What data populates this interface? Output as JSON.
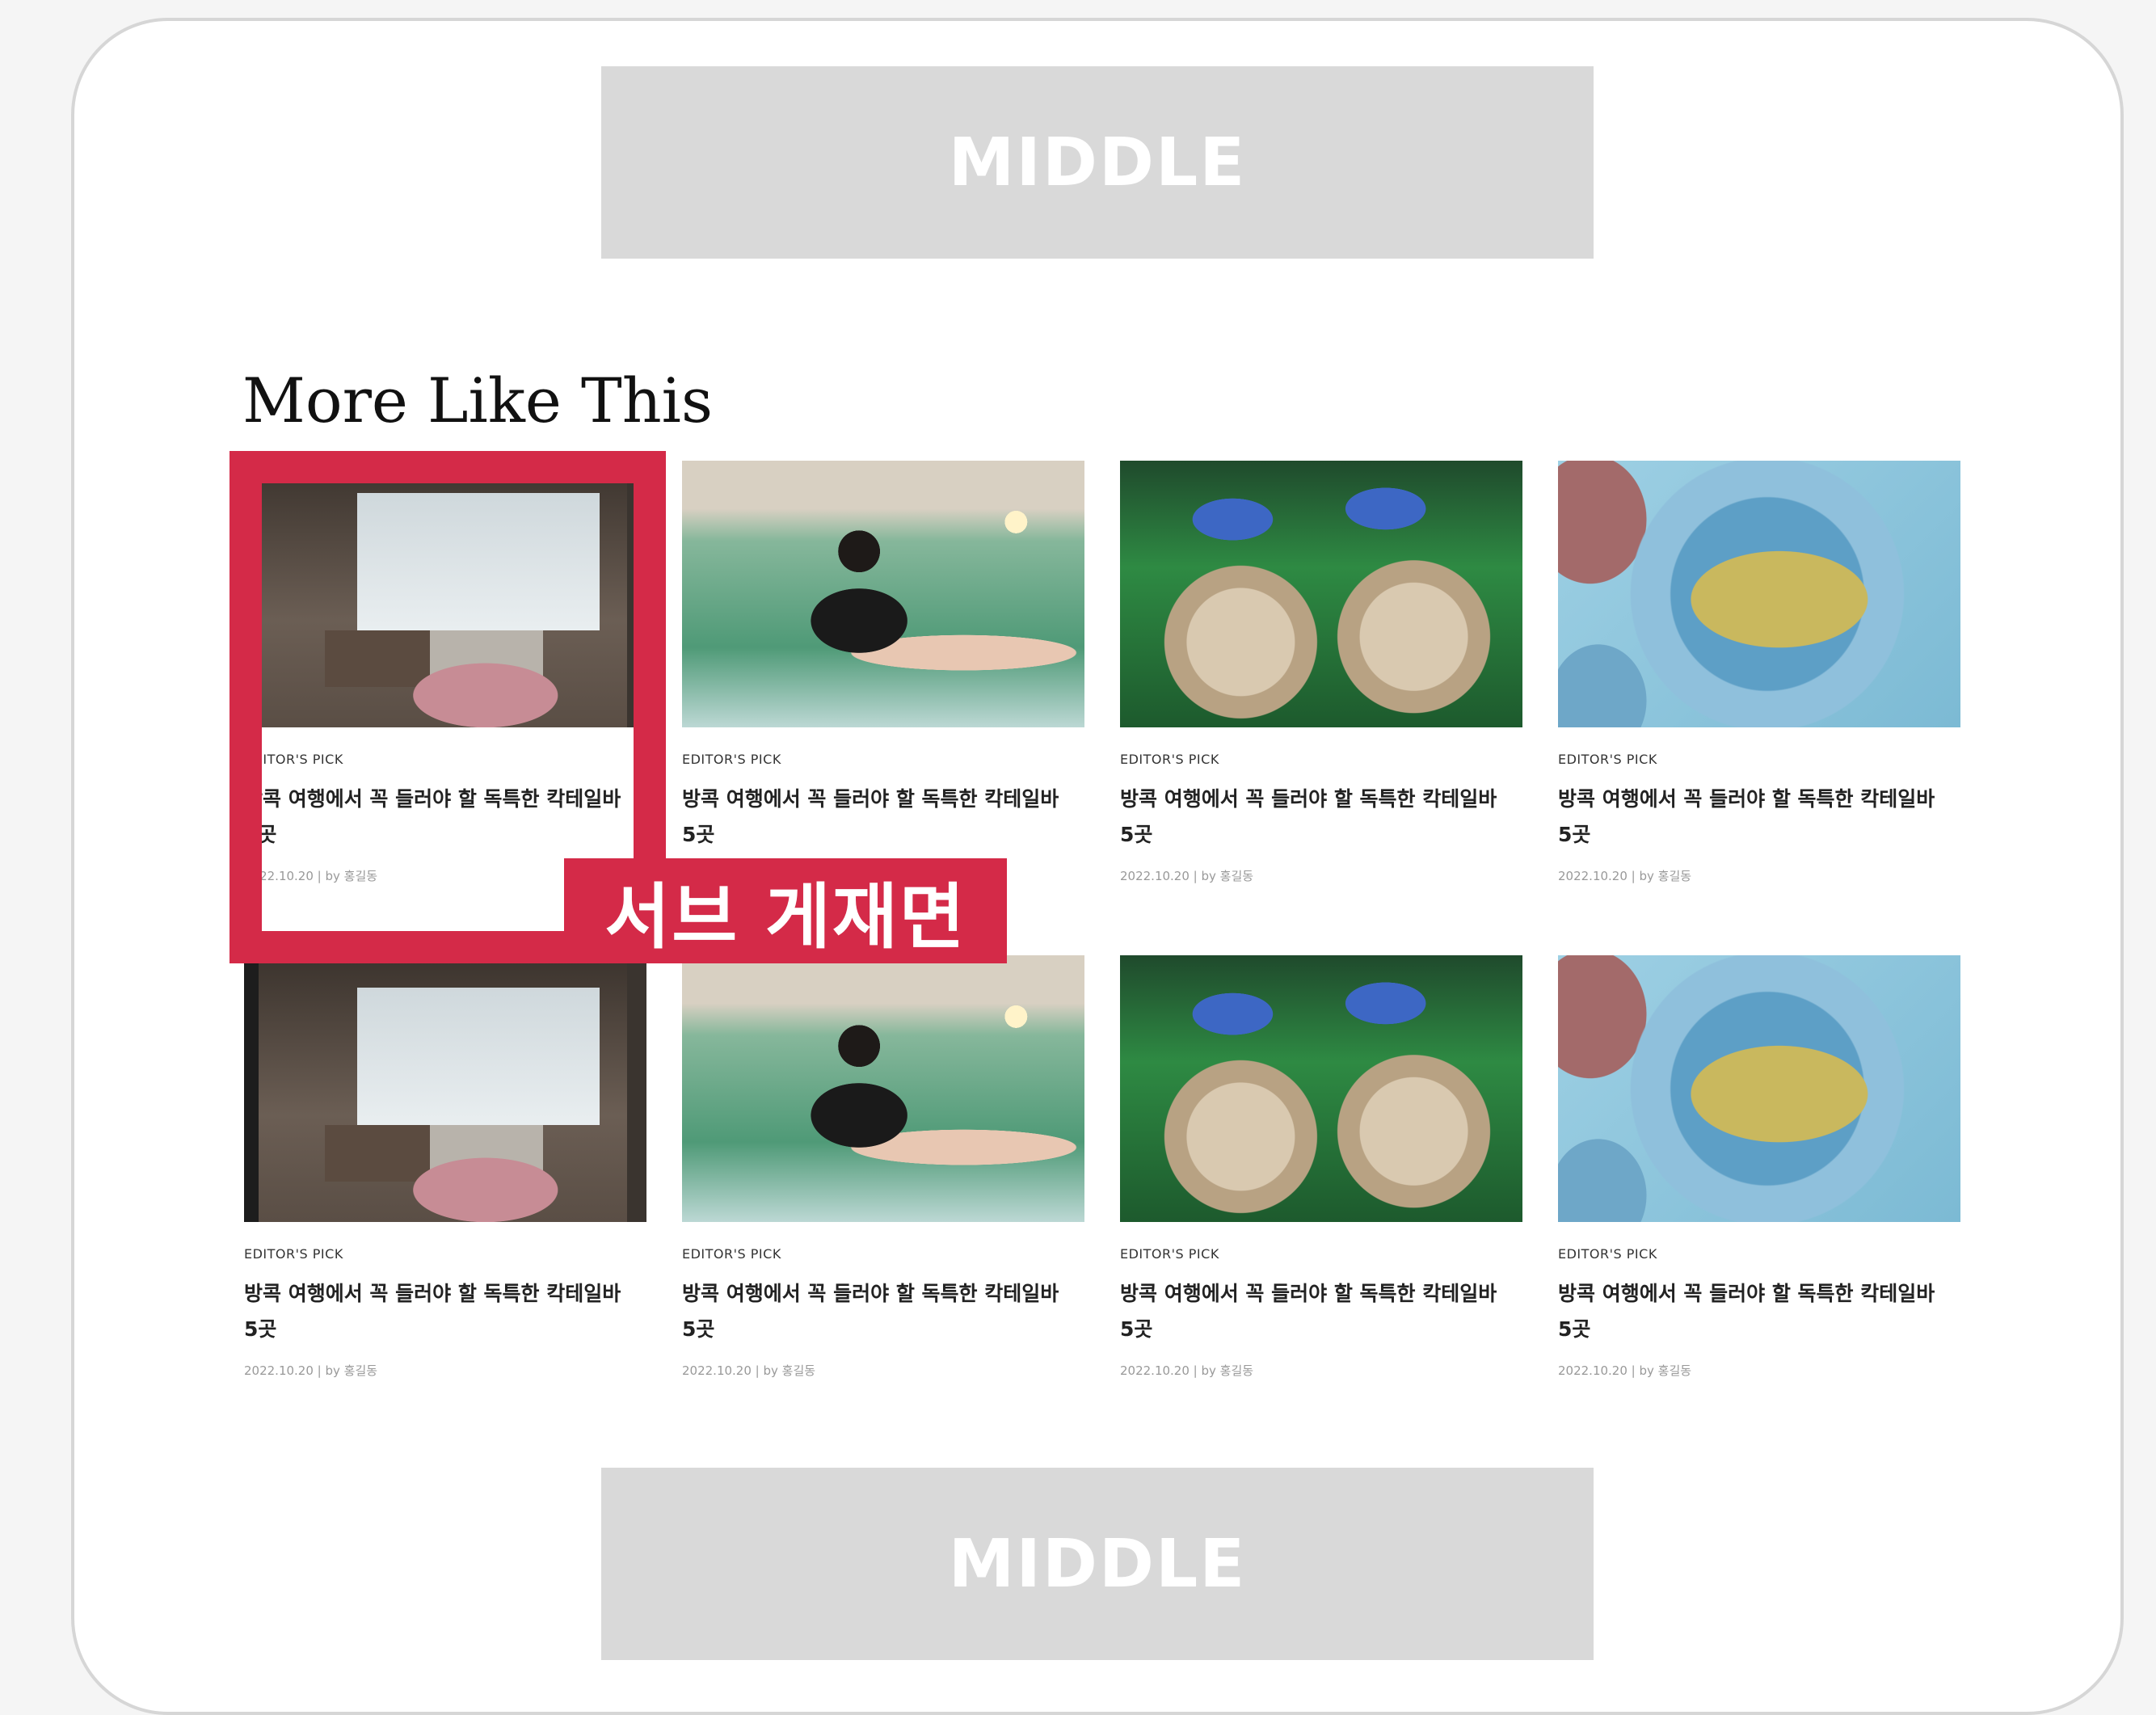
{
  "banners": {
    "top_label": "MIDDLE",
    "bottom_label": "MIDDLE"
  },
  "section_title": "More Like This",
  "cards": [
    {
      "category": "EDITOR'S PICK",
      "title": "방콕 여행에서 꼭 들러야 할 독특한 칵테일바 5곳",
      "meta": "2022.10.20 | by 홍길동",
      "image": "hotel-room-yoga"
    },
    {
      "category": "EDITOR'S PICK",
      "title": "방콕 여행에서 꼭 들러야 할 독특한 칵테일바 5곳",
      "meta": "2022.10.20 | by 홍길동",
      "image": "pool-swimmers"
    },
    {
      "category": "EDITOR'S PICK",
      "title": "방콕 여행에서 꼭 들러야 할 독특한 칵테일바 5곳",
      "meta": "2022.10.20 | by 홍길동",
      "image": "industrial-motors"
    },
    {
      "category": "EDITOR'S PICK",
      "title": "방콕 여행에서 꼭 들러야 할 독특한 칵테일바 5곳",
      "meta": "2022.10.20 | by 홍길동",
      "image": "decorated-plate"
    },
    {
      "category": "EDITOR'S PICK",
      "title": "방콕 여행에서 꼭 들러야 할 독특한 칵테일바 5곳",
      "meta": "2022.10.20 | by 홍길동",
      "image": "hotel-room-yoga"
    },
    {
      "category": "EDITOR'S PICK",
      "title": "방콕 여행에서 꼭 들러야 할 독특한 칵테일바 5곳",
      "meta": "2022.10.20 | by 홍길동",
      "image": "pool-swimmers"
    },
    {
      "category": "EDITOR'S PICK",
      "title": "방콕 여행에서 꼭 들러야 할 독특한 칵테일바 5곳",
      "meta": "2022.10.20 | by 홍길동",
      "image": "industrial-motors"
    },
    {
      "category": "EDITOR'S PICK",
      "title": "방콕 여행에서 꼭 들러야 할 독특한 칵테일바 5곳",
      "meta": "2022.10.20 | by 홍길동",
      "image": "decorated-plate"
    }
  ],
  "annotation": {
    "label": "서브 게재면",
    "color": "#d42a48"
  }
}
